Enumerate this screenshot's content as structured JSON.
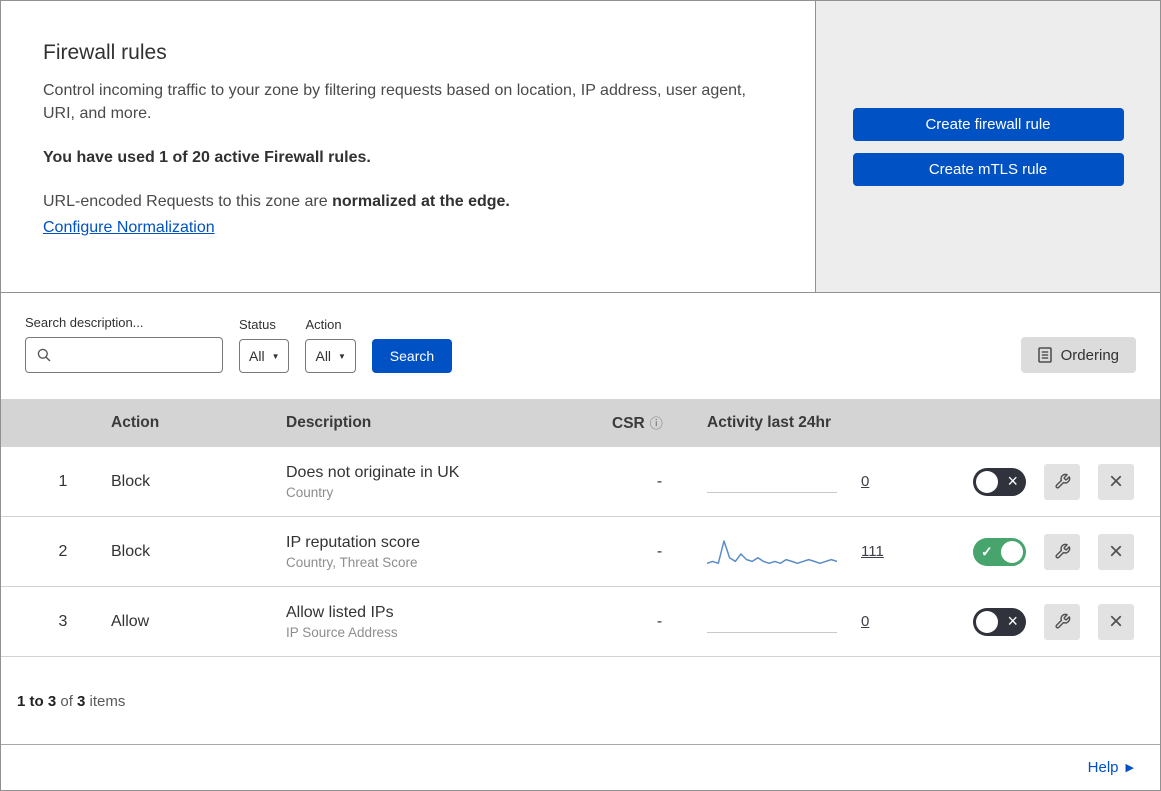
{
  "colors": {
    "primary_blue": "#0051c3",
    "toggle_on_green": "#46a46c",
    "toggle_off_dark": "#30323c",
    "sparkline_blue": "#5b8cc9",
    "table_header_gray": "#d4d4d4"
  },
  "header": {
    "title": "Firewall rules",
    "description": "Control incoming traffic to your zone by filtering requests based on location, IP address, user agent, URI, and more.",
    "usage": "You have used 1 of 20 active Firewall rules.",
    "normalization_prefix": "URL-encoded Requests to this zone are ",
    "normalization_bold": "normalized at the edge.",
    "normalization_link": "Configure Normalization",
    "create_firewall_button": "Create firewall rule",
    "create_mtls_button": "Create mTLS rule"
  },
  "toolbar": {
    "search_label": "Search description...",
    "status_label": "Status",
    "status_value": "All",
    "action_label": "Action",
    "action_value": "All",
    "search_button": "Search",
    "ordering_button": "Ordering"
  },
  "table": {
    "header": {
      "action": "Action",
      "description": "Description",
      "csr": "CSR",
      "csr_info_icon": "ⓘ",
      "activity": "Activity last 24hr"
    },
    "rows": [
      {
        "index": "1",
        "action": "Block",
        "description": "Does not originate in UK",
        "fields": "Country",
        "csr": "-",
        "count": "0",
        "enabled": false,
        "sparkline": []
      },
      {
        "index": "2",
        "action": "Block",
        "description": "IP reputation score",
        "fields": "Country, Threat Score",
        "csr": "-",
        "count": "111",
        "enabled": true,
        "sparkline": [
          2,
          3,
          2,
          14,
          5,
          3,
          7,
          4,
          3,
          5,
          3,
          2,
          3,
          2,
          4,
          3,
          2,
          3,
          4,
          3,
          2,
          3,
          4,
          3
        ]
      },
      {
        "index": "3",
        "action": "Allow",
        "description": "Allow listed IPs",
        "fields": "IP Source Address",
        "csr": "-",
        "count": "0",
        "enabled": false,
        "sparkline": []
      }
    ]
  },
  "footer": {
    "range": "1 to 3",
    "of": " of ",
    "total": "3",
    "items": " items",
    "help": "Help"
  }
}
